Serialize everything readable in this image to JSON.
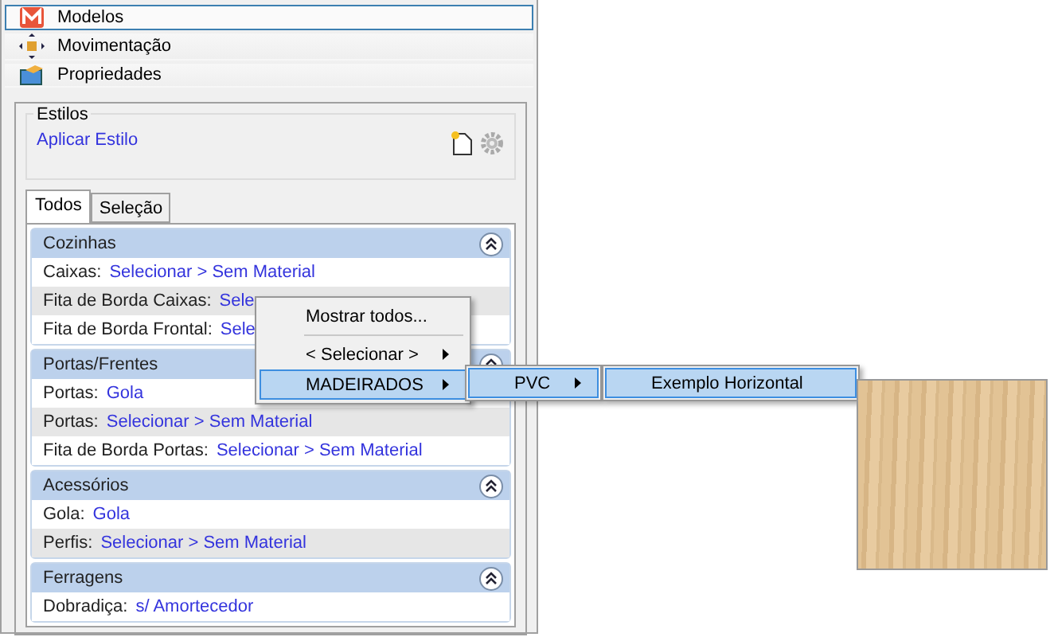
{
  "nav": [
    {
      "label": "Modelos",
      "selected": true
    },
    {
      "label": "Movimentação",
      "selected": false
    },
    {
      "label": "Propriedades",
      "selected": false
    }
  ],
  "styles": {
    "legend": "Estilos",
    "link": "Aplicar Estilo"
  },
  "tabs": [
    {
      "label": "Todos",
      "selected": true
    },
    {
      "label": "Seleção",
      "selected": false
    }
  ],
  "sections": [
    {
      "title": "Cozinhas",
      "rows": [
        {
          "label": "Caixas:",
          "value": "Selecionar > Sem Material"
        },
        {
          "label": "Fita de Borda Caixas:",
          "value": "Sele"
        },
        {
          "label": "Fita de Borda Frontal:",
          "value": "Sele"
        }
      ]
    },
    {
      "title": "Portas/Frentes",
      "rows": [
        {
          "label": "Portas:",
          "value": "Gola"
        },
        {
          "label": "Portas:",
          "value": "Selecionar > Sem Material"
        },
        {
          "label": "Fita de Borda Portas:",
          "value": "Selecionar > Sem Material"
        }
      ]
    },
    {
      "title": "Acessórios",
      "rows": [
        {
          "label": "Gola:",
          "value": "Gola"
        },
        {
          "label": "Perfis:",
          "value": "Selecionar > Sem Material"
        }
      ]
    },
    {
      "title": "Ferragens",
      "rows": [
        {
          "label": "Dobradiça:",
          "value": "s/ Amortecedor"
        }
      ]
    }
  ],
  "menu": [
    {
      "kind": "item",
      "label": "Mostrar todos...",
      "selected": false
    },
    {
      "kind": "separator"
    },
    {
      "kind": "submenu",
      "label": "< Selecionar >",
      "selected": false
    },
    {
      "kind": "submenu",
      "label": "MADEIRADOS",
      "selected": true
    }
  ],
  "submenu": [
    {
      "kind": "submenu",
      "label": "PVC",
      "selected": true
    }
  ],
  "submenu2": [
    {
      "kind": "item",
      "label": "Exemplo Horizontal",
      "selected": true
    }
  ]
}
